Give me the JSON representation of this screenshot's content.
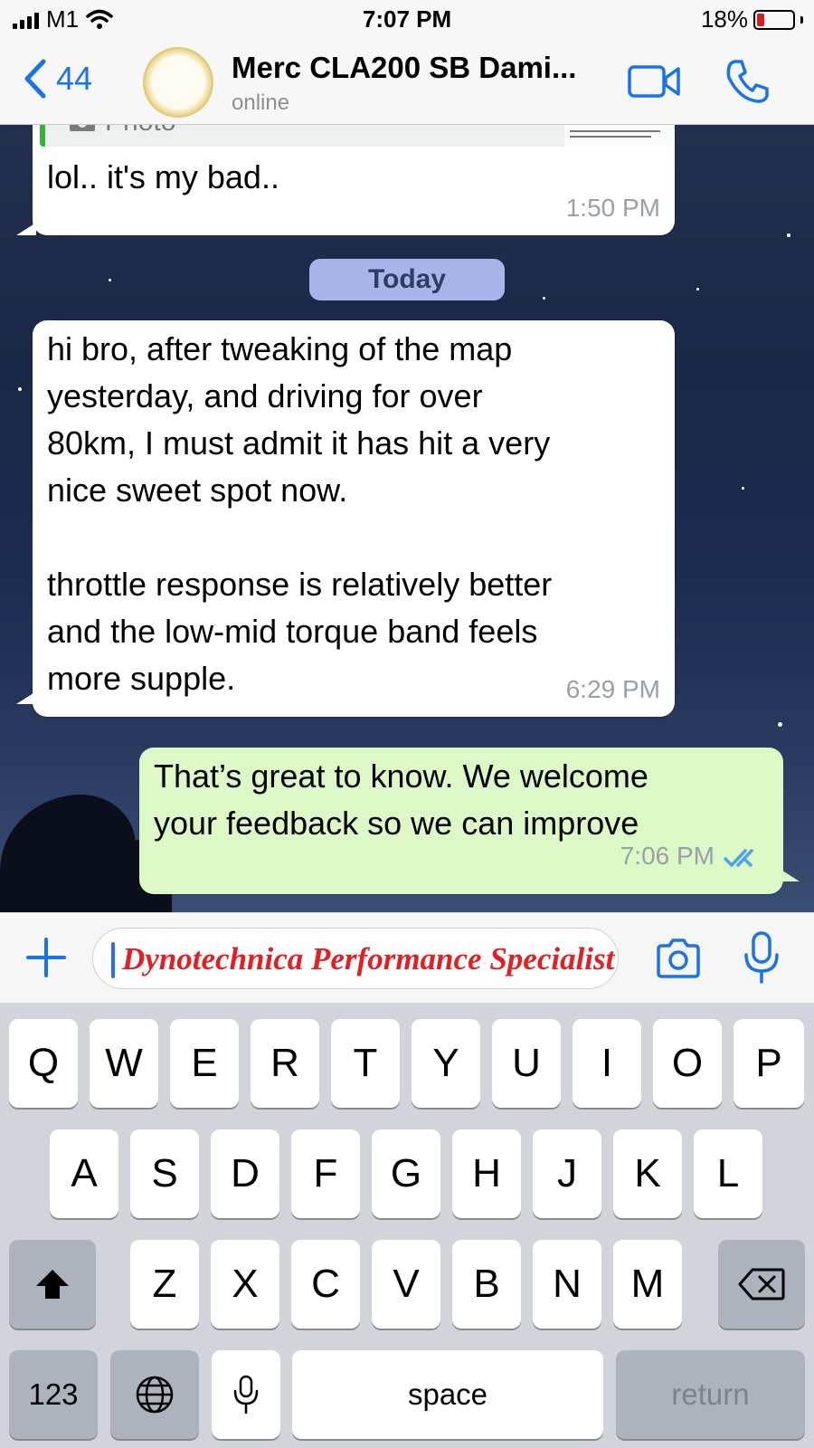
{
  "status_bar": {
    "carrier": "M1",
    "time": "7:07 PM",
    "battery": "18%"
  },
  "nav": {
    "back_count": "44",
    "contact_name": "Merc CLA200 SB Dami...",
    "contact_status": "online"
  },
  "messages": {
    "quoted": {
      "label": "Photo",
      "reply_text": "lol.. it's my bad..",
      "time": "1:50 PM"
    },
    "date_divider": "Today",
    "incoming": {
      "text": "hi bro, after tweaking of the map\nyesterday, and driving for over\n80km, I must admit it has hit a very\nnice sweet spot now.\n\nthrottle response is relatively better\nand the low-mid torque band feels\nmore supple.",
      "time": "6:29 PM"
    },
    "outgoing": {
      "text": "That’s great to know. We welcome\nyour feedback so we can improve",
      "time": "7:06 PM",
      "read_receipt_color": "#4fa3e8"
    }
  },
  "input": {
    "typed_text": "Dynotechnica Performance Specialist"
  },
  "keyboard": {
    "row1": [
      "Q",
      "W",
      "E",
      "R",
      "T",
      "Y",
      "U",
      "I",
      "O",
      "P"
    ],
    "row2": [
      "A",
      "S",
      "D",
      "F",
      "G",
      "H",
      "J",
      "K",
      "L"
    ],
    "row3": [
      "Z",
      "X",
      "C",
      "V",
      "B",
      "N",
      "M"
    ],
    "numbers_key": "123",
    "space_key": "space",
    "return_key": "return"
  },
  "colors": {
    "accent": "#1a73e8",
    "outgoing_bubble": "#dcf8c6",
    "quote_bar": "#35b33a",
    "typed_text": "#e41e22"
  }
}
